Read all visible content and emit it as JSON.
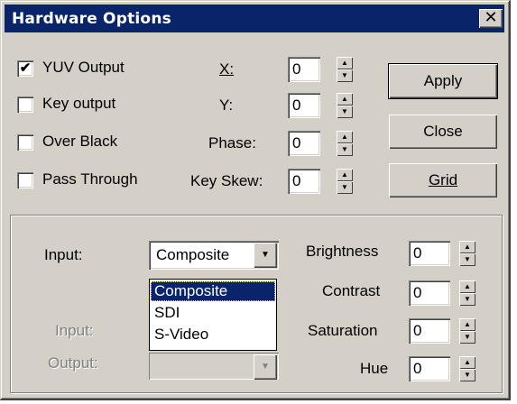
{
  "window": {
    "title": "Hardware Options",
    "close_glyph": "✕"
  },
  "checkboxes": [
    {
      "label": "YUV Output",
      "checked": true
    },
    {
      "label": "Key output",
      "checked": false
    },
    {
      "label": "Over Black",
      "checked": false
    },
    {
      "label": "Pass Through",
      "checked": false
    }
  ],
  "fields": [
    {
      "label": "X:",
      "value": "0"
    },
    {
      "label": "Y:",
      "value": "0"
    },
    {
      "label": "Phase:",
      "value": "0"
    },
    {
      "label": "Key Skew:",
      "value": "0"
    }
  ],
  "buttons": {
    "apply": "Apply",
    "close": "Close",
    "grid": "Grid"
  },
  "input": {
    "label": "Input:",
    "selected": "Composite",
    "options": [
      "Composite",
      "SDI",
      "S-Video"
    ]
  },
  "disabled": {
    "input_label": "Input:",
    "output_label": "Output:"
  },
  "video_adjust": [
    {
      "label": "Brightness",
      "value": "0"
    },
    {
      "label": "Contrast",
      "value": "0"
    },
    {
      "label": "Saturation",
      "value": "0"
    },
    {
      "label": "Hue",
      "value": "0"
    }
  ],
  "colors": {
    "titlebar": "#0a246a",
    "face": "#d4d0c8",
    "selection": "#0a246a"
  }
}
